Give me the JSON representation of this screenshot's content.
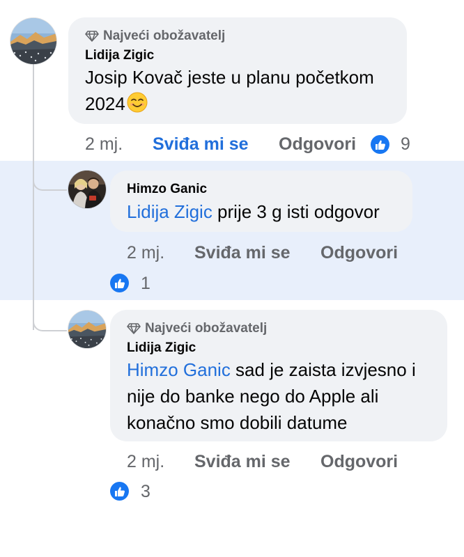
{
  "comments": [
    {
      "badge": "Najveći obožavatelj",
      "author": "Lidija Zigic",
      "text_line1": "Josip Kovač jeste u planu početkom",
      "text_line2": "2024",
      "emoji": "smiling-face-emoji",
      "time": "2 mj.",
      "like_label": "Sviđa mi se",
      "reply_label": "Odgovori",
      "reactions": "9"
    },
    {
      "author": "Himzo Ganic",
      "mention": "Lidija Zigic",
      "text": " prije 3 g isti odgovor",
      "time": "2 mj.",
      "like_label": "Sviđa mi se",
      "reply_label": "Odgovori",
      "reactions": "1"
    },
    {
      "badge": "Najveći obožavatelj",
      "author": "Lidija Zigic",
      "mention": "Himzo Ganic",
      "text_line1": " sad je zaista izvjesno i",
      "text_line2": "nije do banke nego do Apple ali",
      "text_line3": "konačno smo dobili datume",
      "time": "2 mj.",
      "like_label": "Sviđa mi se",
      "reply_label": "Odgovori",
      "reactions": "3"
    }
  ],
  "colors": {
    "highlight": "#e8effb",
    "link": "#216fdb",
    "reaction": "#1877f2"
  }
}
